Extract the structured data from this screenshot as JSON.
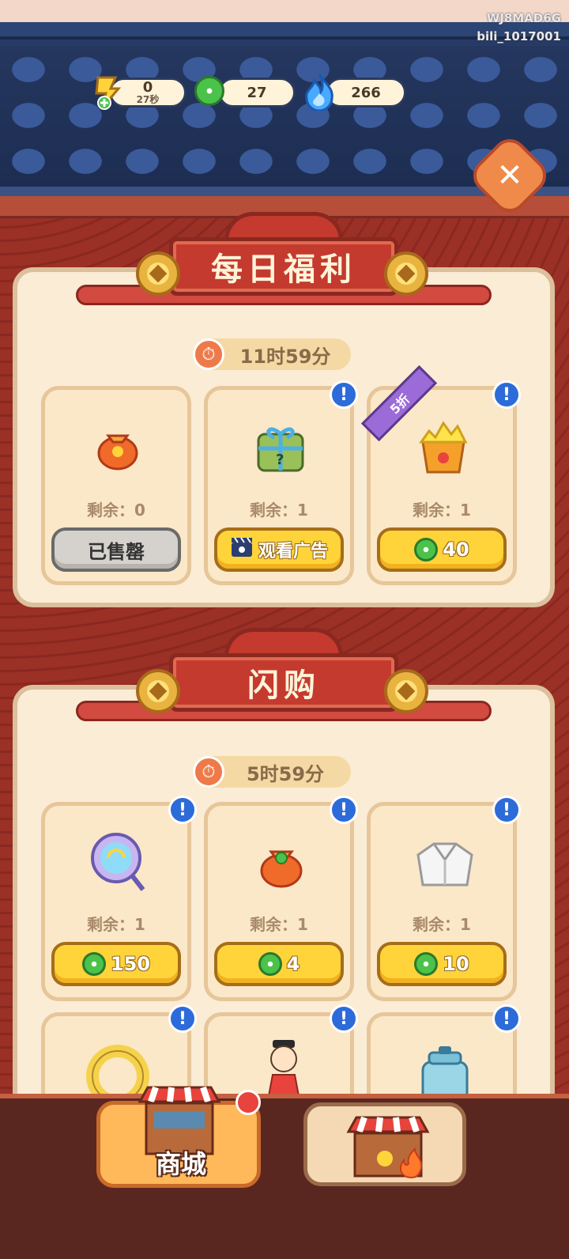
{
  "watermark": {
    "line1": "WJ8MAD6G",
    "line2": "bili_1017001"
  },
  "resources": {
    "energy": {
      "value": "0",
      "timer": "27秒",
      "icon": "lightning-plus-icon"
    },
    "jade": {
      "value": "27",
      "icon": "jade-coin-icon"
    },
    "flame": {
      "value": "266",
      "icon": "blue-flame-icon"
    }
  },
  "daily": {
    "title": "每日福利",
    "timer": "11时59分",
    "items": [
      {
        "stock": "剩余：0",
        "button": "已售罄",
        "icon": "lucky-bag-icon"
      },
      {
        "stock": "剩余：1",
        "button": "观看广告",
        "icon": "mystery-gift-icon",
        "button_icon": "video-clapper-icon"
      },
      {
        "stock": "剩余：1",
        "price": "40",
        "badge": "5折",
        "icon": "gold-nugget-bucket-icon"
      }
    ]
  },
  "flash": {
    "title": "闪购",
    "timer": "5时59分",
    "items": [
      {
        "stock": "剩余：1",
        "price": "150",
        "icon": "magic-mirror-icon"
      },
      {
        "stock": "剩余：1",
        "price": "4",
        "icon": "jade-lucky-bag-icon"
      },
      {
        "stock": "剩余：1",
        "price": "10",
        "icon": "white-robe-icon"
      }
    ],
    "partial_items": [
      "lifebuoy-icon",
      "scholar-character-icon",
      "steamer-pot-icon"
    ]
  },
  "bottom_tabs": [
    {
      "label": "商城",
      "icon": "shop-stall-icon",
      "active": true
    },
    {
      "label": "",
      "icon": "hot-shop-stall-icon",
      "active": false
    }
  ],
  "colors": {
    "accent_red": "#c53a2e",
    "button_yellow": "#ffd43a",
    "info_blue": "#2d6bd9",
    "discount_purple": "#9b6bd8"
  }
}
